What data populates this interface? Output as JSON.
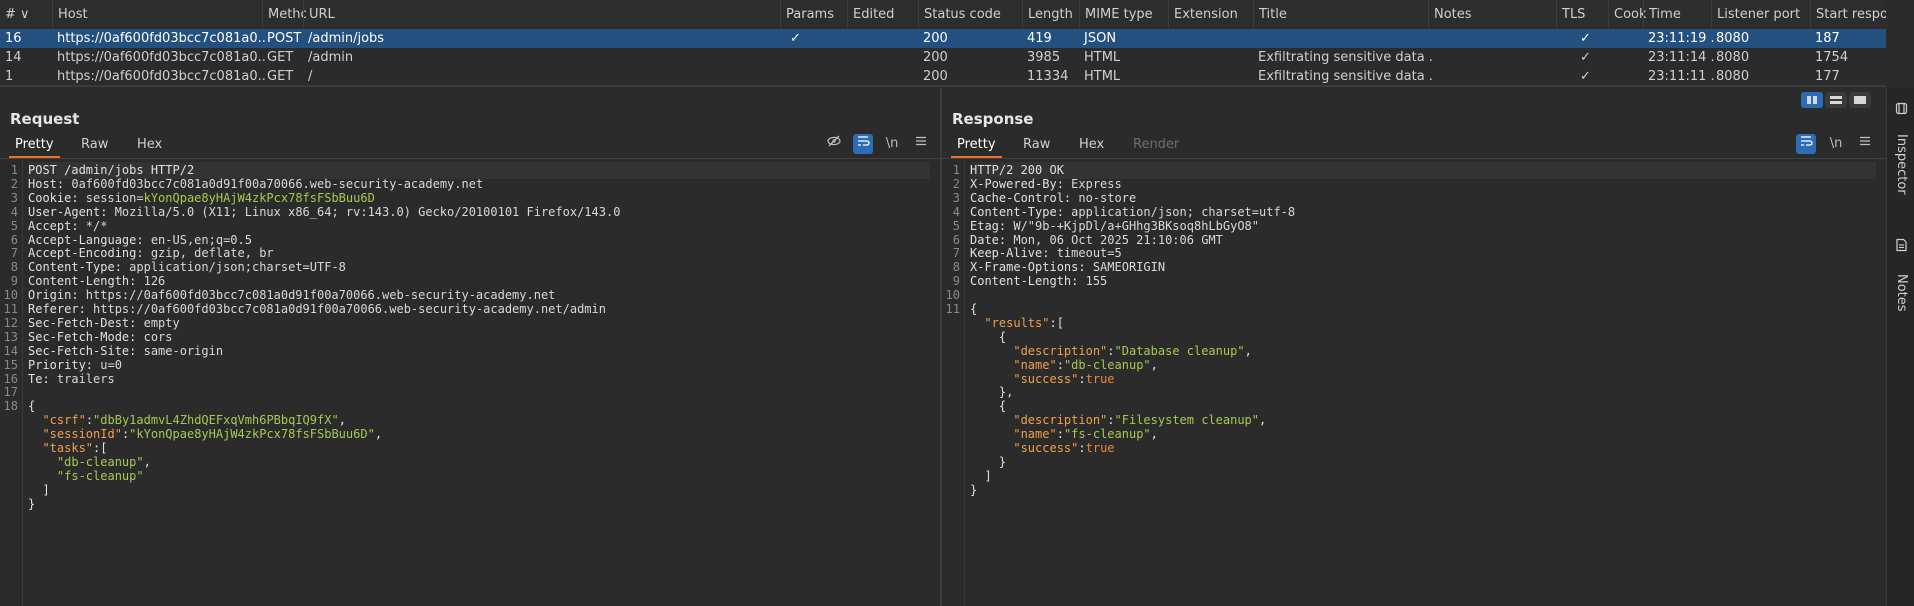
{
  "table": {
    "columns": [
      "#",
      "Host",
      "Method",
      "URL",
      "Params",
      "Edited",
      "Status code",
      "Length",
      "MIME type",
      "Extension",
      "Title",
      "Notes",
      "TLS",
      "Cookies",
      "Time",
      "Listener port",
      "Start response"
    ],
    "column_labels_shown": [
      "# ∨",
      "Host",
      "Metho",
      "URL",
      "Params",
      "Edited",
      "Status code",
      "Length",
      "MIME type",
      "Extension",
      "Title",
      "Notes",
      "TLS",
      "Cook",
      "Time",
      "Listener port",
      "Start response"
    ],
    "rows": [
      {
        "num": "16",
        "host": "https://0af600fd03bcc7c081a0...",
        "method": "POST",
        "url": "/admin/jobs",
        "params": "✓",
        "edited": "",
        "status": "200",
        "length": "419",
        "mime": "JSON",
        "ext": "",
        "title": "",
        "notes": "",
        "tls": "✓",
        "cookies": "",
        "time": "23:11:19 ...",
        "port": "8080",
        "start": "187",
        "selected": true
      },
      {
        "num": "14",
        "host": "https://0af600fd03bcc7c081a0...",
        "method": "GET",
        "url": "/admin",
        "params": "",
        "edited": "",
        "status": "200",
        "length": "3985",
        "mime": "HTML",
        "ext": "",
        "title": "Exfiltrating sensitive data ...",
        "notes": "",
        "tls": "✓",
        "cookies": "",
        "time": "23:11:14 ...",
        "port": "8080",
        "start": "1754",
        "selected": false
      },
      {
        "num": "1",
        "host": "https://0af600fd03bcc7c081a0...",
        "method": "GET",
        "url": "/",
        "params": "",
        "edited": "",
        "status": "200",
        "length": "11334",
        "mime": "HTML",
        "ext": "",
        "title": "Exfiltrating sensitive data ...",
        "notes": "",
        "tls": "✓",
        "cookies": "",
        "time": "23:11:11 ...",
        "port": "8080",
        "start": "177",
        "selected": false
      }
    ]
  },
  "request": {
    "title": "Request",
    "tabs": [
      "Pretty",
      "Raw",
      "Hex"
    ],
    "icons": [
      "eye-slash-icon",
      "wrap-icon",
      "newline-icon",
      "menu-icon"
    ],
    "newline_label": "\\n",
    "lines": [
      {
        "n": "1",
        "parts": [
          {
            "t": "POST /admin/jobs HTTP/2",
            "c": "k"
          }
        ]
      },
      {
        "n": "2",
        "parts": [
          {
            "t": "Host: ",
            "c": "k"
          },
          {
            "t": "0af600fd03bcc7c081a0d91f00a70066.web-security-academy.net",
            "c": "v"
          }
        ]
      },
      {
        "n": "3",
        "parts": [
          {
            "t": "Cookie: ",
            "c": "k"
          },
          {
            "t": "session",
            "c": "v"
          },
          {
            "t": "=",
            "c": "v"
          },
          {
            "t": "kYonQpae8yHAjW4zkPcx78fsFSbBuu6D",
            "c": "c"
          }
        ]
      },
      {
        "n": "4",
        "parts": [
          {
            "t": "User-Agent: ",
            "c": "k"
          },
          {
            "t": "Mozilla/5.0 (X11; Linux x86_64; rv:143.0) Gecko/20100101 Firefox/143.0",
            "c": "v"
          }
        ]
      },
      {
        "n": "5",
        "parts": [
          {
            "t": "Accept: ",
            "c": "k"
          },
          {
            "t": "*/*",
            "c": "v"
          }
        ]
      },
      {
        "n": "6",
        "parts": [
          {
            "t": "Accept-Language: ",
            "c": "k"
          },
          {
            "t": "en-US,en;q=0.5",
            "c": "v"
          }
        ]
      },
      {
        "n": "7",
        "parts": [
          {
            "t": "Accept-Encoding: ",
            "c": "k"
          },
          {
            "t": "gzip, deflate, br",
            "c": "v"
          }
        ]
      },
      {
        "n": "8",
        "parts": [
          {
            "t": "Content-Type: ",
            "c": "k"
          },
          {
            "t": "application/json;charset=UTF-8",
            "c": "v"
          }
        ]
      },
      {
        "n": "9",
        "parts": [
          {
            "t": "Content-Length: ",
            "c": "k"
          },
          {
            "t": "126",
            "c": "v"
          }
        ]
      },
      {
        "n": "10",
        "parts": [
          {
            "t": "Origin: ",
            "c": "k"
          },
          {
            "t": "https://0af600fd03bcc7c081a0d91f00a70066.web-security-academy.net",
            "c": "v"
          }
        ]
      },
      {
        "n": "11",
        "parts": [
          {
            "t": "Referer: ",
            "c": "k"
          },
          {
            "t": "https://0af600fd03bcc7c081a0d91f00a70066.web-security-academy.net/admin",
            "c": "v"
          }
        ]
      },
      {
        "n": "12",
        "parts": [
          {
            "t": "Sec-Fetch-Dest: ",
            "c": "k"
          },
          {
            "t": "empty",
            "c": "v"
          }
        ]
      },
      {
        "n": "13",
        "parts": [
          {
            "t": "Sec-Fetch-Mode: ",
            "c": "k"
          },
          {
            "t": "cors",
            "c": "v"
          }
        ]
      },
      {
        "n": "14",
        "parts": [
          {
            "t": "Sec-Fetch-Site: ",
            "c": "k"
          },
          {
            "t": "same-origin",
            "c": "v"
          }
        ]
      },
      {
        "n": "15",
        "parts": [
          {
            "t": "Priority: ",
            "c": "k"
          },
          {
            "t": "u=0",
            "c": "v"
          }
        ]
      },
      {
        "n": "16",
        "parts": [
          {
            "t": "Te: ",
            "c": "k"
          },
          {
            "t": "trailers",
            "c": "v"
          }
        ]
      },
      {
        "n": "17",
        "parts": []
      },
      {
        "n": "18",
        "parts": [
          {
            "t": "{",
            "c": "k"
          }
        ]
      },
      {
        "n": "",
        "parts": [
          {
            "t": "  ",
            "c": "k"
          },
          {
            "t": "\"csrf\"",
            "c": "jk"
          },
          {
            "t": ":",
            "c": "k"
          },
          {
            "t": "\"dbBy1admvL4ZhdQEFxqVmh6PBbqIQ9fX\"",
            "c": "js"
          },
          {
            "t": ",",
            "c": "k"
          }
        ]
      },
      {
        "n": "",
        "parts": [
          {
            "t": "  ",
            "c": "k"
          },
          {
            "t": "\"sessionId\"",
            "c": "jk"
          },
          {
            "t": ":",
            "c": "k"
          },
          {
            "t": "\"kYonQpae8yHAjW4zkPcx78fsFSbBuu6D\"",
            "c": "js"
          },
          {
            "t": ",",
            "c": "k"
          }
        ]
      },
      {
        "n": "",
        "parts": [
          {
            "t": "  ",
            "c": "k"
          },
          {
            "t": "\"tasks\"",
            "c": "jk"
          },
          {
            "t": ":[",
            "c": "k"
          }
        ]
      },
      {
        "n": "",
        "parts": [
          {
            "t": "    ",
            "c": "k"
          },
          {
            "t": "\"db-cleanup\"",
            "c": "js"
          },
          {
            "t": ",",
            "c": "k"
          }
        ]
      },
      {
        "n": "",
        "parts": [
          {
            "t": "    ",
            "c": "k"
          },
          {
            "t": "\"fs-cleanup\"",
            "c": "js"
          }
        ]
      },
      {
        "n": "",
        "parts": [
          {
            "t": "  ]",
            "c": "k"
          }
        ]
      },
      {
        "n": "",
        "parts": [
          {
            "t": "}",
            "c": "k"
          }
        ]
      }
    ]
  },
  "response": {
    "title": "Response",
    "tabs": [
      "Pretty",
      "Raw",
      "Hex",
      "Render"
    ],
    "icons": [
      "wrap-icon",
      "newline-icon",
      "menu-icon"
    ],
    "newline_label": "\\n",
    "lines": [
      {
        "n": "1",
        "parts": [
          {
            "t": "HTTP/2 200 OK",
            "c": "k"
          }
        ]
      },
      {
        "n": "2",
        "parts": [
          {
            "t": "X-Powered-By: ",
            "c": "k"
          },
          {
            "t": "Express",
            "c": "v"
          }
        ]
      },
      {
        "n": "3",
        "parts": [
          {
            "t": "Cache-Control: ",
            "c": "k"
          },
          {
            "t": "no-store",
            "c": "v"
          }
        ]
      },
      {
        "n": "4",
        "parts": [
          {
            "t": "Content-Type: ",
            "c": "k"
          },
          {
            "t": "application/json; charset=utf-8",
            "c": "v"
          }
        ]
      },
      {
        "n": "5",
        "parts": [
          {
            "t": "Etag: ",
            "c": "k"
          },
          {
            "t": "W/\"9b-+KjpDl/a+GHhg3BKsoq8hLbGyO8\"",
            "c": "v"
          }
        ]
      },
      {
        "n": "6",
        "parts": [
          {
            "t": "Date: ",
            "c": "k"
          },
          {
            "t": "Mon, 06 Oct 2025 21:10:06 GMT",
            "c": "v"
          }
        ]
      },
      {
        "n": "7",
        "parts": [
          {
            "t": "Keep-Alive: ",
            "c": "k"
          },
          {
            "t": "timeout=5",
            "c": "v"
          }
        ]
      },
      {
        "n": "8",
        "parts": [
          {
            "t": "X-Frame-Options: ",
            "c": "k"
          },
          {
            "t": "SAMEORIGIN",
            "c": "v"
          }
        ]
      },
      {
        "n": "9",
        "parts": [
          {
            "t": "Content-Length: ",
            "c": "k"
          },
          {
            "t": "155",
            "c": "v"
          }
        ]
      },
      {
        "n": "10",
        "parts": []
      },
      {
        "n": "11",
        "parts": [
          {
            "t": "{",
            "c": "k"
          }
        ]
      },
      {
        "n": "",
        "parts": [
          {
            "t": "  ",
            "c": "k"
          },
          {
            "t": "\"results\"",
            "c": "jk"
          },
          {
            "t": ":[",
            "c": "k"
          }
        ]
      },
      {
        "n": "",
        "parts": [
          {
            "t": "    {",
            "c": "k"
          }
        ]
      },
      {
        "n": "",
        "parts": [
          {
            "t": "      ",
            "c": "k"
          },
          {
            "t": "\"description\"",
            "c": "jk"
          },
          {
            "t": ":",
            "c": "k"
          },
          {
            "t": "\"Database cleanup\"",
            "c": "js"
          },
          {
            "t": ",",
            "c": "k"
          }
        ]
      },
      {
        "n": "",
        "parts": [
          {
            "t": "      ",
            "c": "k"
          },
          {
            "t": "\"name\"",
            "c": "jk"
          },
          {
            "t": ":",
            "c": "k"
          },
          {
            "t": "\"db-cleanup\"",
            "c": "js"
          },
          {
            "t": ",",
            "c": "k"
          }
        ]
      },
      {
        "n": "",
        "parts": [
          {
            "t": "      ",
            "c": "k"
          },
          {
            "t": "\"success\"",
            "c": "jk"
          },
          {
            "t": ":",
            "c": "k"
          },
          {
            "t": "true",
            "c": "jb"
          }
        ]
      },
      {
        "n": "",
        "parts": [
          {
            "t": "    },",
            "c": "k"
          }
        ]
      },
      {
        "n": "",
        "parts": [
          {
            "t": "    {",
            "c": "k"
          }
        ]
      },
      {
        "n": "",
        "parts": [
          {
            "t": "      ",
            "c": "k"
          },
          {
            "t": "\"description\"",
            "c": "jk"
          },
          {
            "t": ":",
            "c": "k"
          },
          {
            "t": "\"Filesystem cleanup\"",
            "c": "js"
          },
          {
            "t": ",",
            "c": "k"
          }
        ]
      },
      {
        "n": "",
        "parts": [
          {
            "t": "      ",
            "c": "k"
          },
          {
            "t": "\"name\"",
            "c": "jk"
          },
          {
            "t": ":",
            "c": "k"
          },
          {
            "t": "\"fs-cleanup\"",
            "c": "js"
          },
          {
            "t": ",",
            "c": "k"
          }
        ]
      },
      {
        "n": "",
        "parts": [
          {
            "t": "      ",
            "c": "k"
          },
          {
            "t": "\"success\"",
            "c": "jk"
          },
          {
            "t": ":",
            "c": "k"
          },
          {
            "t": "true",
            "c": "jb"
          }
        ]
      },
      {
        "n": "",
        "parts": [
          {
            "t": "    }",
            "c": "k"
          }
        ]
      },
      {
        "n": "",
        "parts": [
          {
            "t": "  ]",
            "c": "k"
          }
        ]
      },
      {
        "n": "",
        "parts": [
          {
            "t": "}",
            "c": "k"
          }
        ]
      }
    ]
  },
  "sidebar": {
    "tabs": [
      {
        "label": "Inspector",
        "icon": "inspector-icon"
      },
      {
        "label": "Notes",
        "icon": "notes-icon"
      }
    ]
  },
  "layout_buttons": [
    "split-horizontal-icon",
    "split-vertical-icon",
    "single-panel-icon"
  ],
  "colors": {
    "selected_row": "#24507f",
    "accent_tab": "#e8732a",
    "toggle_on": "#2d6db5",
    "json_key": "#f0a04b",
    "json_string": "#a6c952",
    "json_bool": "#e8873a"
  }
}
